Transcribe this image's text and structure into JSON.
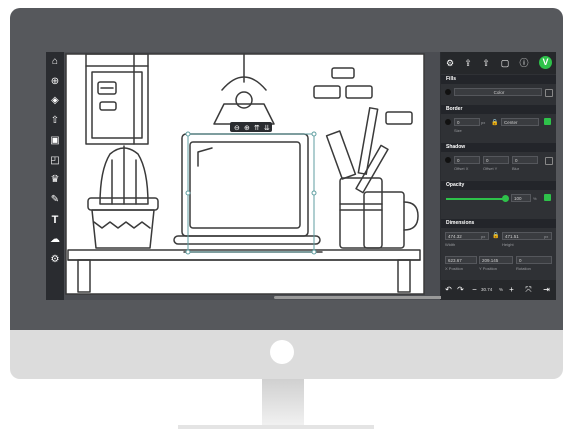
{
  "left_toolbar": {
    "home": "⌂",
    "new_file": "⊕",
    "layers": "◈",
    "upload": "⇧",
    "image": "▣",
    "shapes": "◰",
    "clipart": "♛",
    "pen": "✎",
    "text": "T",
    "cloud": "☁",
    "settings": "⚙"
  },
  "top_toolbar": {
    "icons": [
      "⚙",
      "⇪",
      "⇧",
      "▢",
      "ⓘ"
    ],
    "logo": "V"
  },
  "object_toolbar": [
    "⊖",
    "⊕",
    "⇈",
    "⇊"
  ],
  "fills": {
    "header": "Fills",
    "value": "Color"
  },
  "border": {
    "header": "Border",
    "width": "0",
    "unit": "px",
    "style_label": "Size",
    "position": "Center"
  },
  "shadow": {
    "header": "Shadow",
    "x": "0",
    "y": "0",
    "blur": "0",
    "unit": "px",
    "labels": [
      "Offset X",
      "Offset Y",
      "Blur"
    ]
  },
  "opacity": {
    "header": "Opacity",
    "value": "100",
    "unit": "%",
    "level": 1.0
  },
  "dimensions": {
    "header": "Dimensions",
    "width": "474.32",
    "height": "471.51",
    "unit": "px",
    "width_label": "Width",
    "height_label": "Height",
    "x": "623.67",
    "y": "209.145",
    "rotation": "0",
    "x_label": "X Position",
    "y_label": "Y Position",
    "rotation_label": "Rotation"
  },
  "bottom_bar": {
    "undo": "↶",
    "redo": "↷",
    "zoom_out": "−",
    "zoom": "30.74",
    "zoom_unit": "%",
    "zoom_in": "+",
    "fit": "⤧",
    "export": "⇥"
  },
  "colors": {
    "bezel": "#56585c",
    "panel": "#2f3135",
    "accent": "#2ec24a",
    "selection": "#5f9ea0"
  }
}
